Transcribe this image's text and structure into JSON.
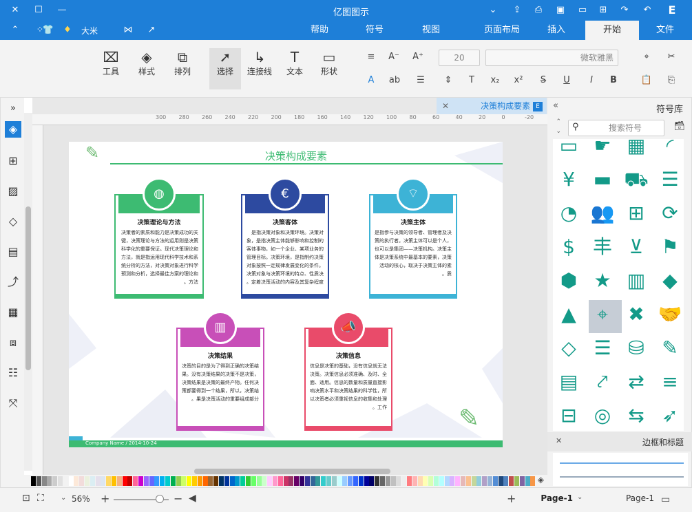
{
  "app": {
    "title": "亿图图示"
  },
  "menu": {
    "items": [
      "文件",
      "开始",
      "插入",
      "页面布局",
      "视图",
      "符号",
      "帮助"
    ],
    "active": "开始"
  },
  "user": {
    "name": "大米"
  },
  "ribbon": {
    "font_name": "微软雅黑",
    "font_size": "20",
    "shape_label": "形状",
    "text_label": "文本",
    "connector_label": "连接线",
    "select_label": "选择",
    "arrange_label": "排列",
    "style_label": "样式",
    "tools_label": "工具"
  },
  "document": {
    "tab_title": "决策构成要素"
  },
  "ruler": {
    "ticks": [
      "-20",
      "0",
      "20",
      "40",
      "60",
      "80",
      "100",
      "120",
      "140",
      "160",
      "180",
      "200",
      "220",
      "240",
      "260",
      "280",
      "300"
    ]
  },
  "diagram": {
    "title": "决策构成要素",
    "footer": "Company Name / 2014-10-24",
    "cards": [
      {
        "title": "决策主体",
        "body": "是指参与决策的领导者、管理者及决策的执行者。决策主体可以是个人，也可以是集团——决策机构。决策主体是决策系统中最基本的要素，决策活动的核心，取决于决策主体的素质。",
        "color": "#3db3d6",
        "icon": "wifi-icon"
      },
      {
        "title": "决策客体",
        "body": "是指决策对象和决策环境。决策对象，是指决策主体能够影响和控制的客体事物，如一个企业、某项业务的管理目标。决策环境，是指制约决策对象按照一定规律发展变化的条件。决策对象与决策环境的特点、性质决定着决策活动的内容及其复杂程度。",
        "color": "#2d4aa0",
        "icon": "euro-icon"
      },
      {
        "title": "决策理论与方法",
        "body": "决策者的素质和能力是决策成功的关键，决策理论与方法的运用则是决策科学化的重要保证。现代决策理论和方法，就是指运用现代科学技术和系统分析的方法，对决策对象进行科学预测和分析，选择最佳方案的理论和方法。",
        "color": "#3dbb72",
        "icon": "basketball-icon"
      },
      {
        "title": "决策信息",
        "body": "信息是决策的基础，没有信息就无法决策。决策信息必须准确、及时、全面、适用。信息的数量和质量直接影响决策水平和决策结果的科学性，所以决策者必须重视信息的收集和处理工作。",
        "color": "#e94b6a",
        "icon": "megaphone-icon"
      },
      {
        "title": "决策结果",
        "body": "决策的目的是为了得到正确的决策结果。没有决策结果的决策不是决策，决策结果是决策的最终产物。任何决策都要得到一个结果，所以，决策结果是决策活动的重要组成部分。",
        "color": "#c84fb8",
        "icon": "chart-icon"
      }
    ]
  },
  "right_panel": {
    "title": "符号库",
    "search_placeholder": "搜索符号",
    "section_label": "边框和标题"
  },
  "status": {
    "page_tab": "Page-1",
    "page_select": "Page-1",
    "zoom": "56%"
  },
  "palette_colors": [
    "#000000",
    "#555555",
    "#888888",
    "#aaaaaa",
    "#cccccc",
    "#e0e0e0",
    "#f2f2f2",
    "#ffffff",
    "#fde9d9",
    "#f2dcdb",
    "#ebf1de",
    "#dbeef3",
    "#e5e0ec",
    "#dce6f1",
    "#ffd966",
    "#ffc000",
    "#f4b183",
    "#ff0000",
    "#c00000",
    "#ff6699",
    "#cc00cc",
    "#9966ff",
    "#6666ff",
    "#3399ff",
    "#00b0f0",
    "#00cccc",
    "#00b050",
    "#92d050",
    "#ccff66",
    "#ffff00",
    "#ffcc00",
    "#ff9900",
    "#ff6600",
    "#996633",
    "#663300",
    "#003366",
    "#003399",
    "#0066cc",
    "#0099cc",
    "#00cc99",
    "#33cc33",
    "#66ff66",
    "#99ff99",
    "#ccffcc",
    "#ffccff",
    "#ff99cc",
    "#ff6699",
    "#cc3366",
    "#993366",
    "#660066",
    "#330066",
    "#333399",
    "#336699",
    "#339999",
    "#33cccc",
    "#66cccc",
    "#99cccc",
    "#ccffff",
    "#99ccff",
    "#6699ff",
    "#3366ff",
    "#0033cc",
    "#000099",
    "#000066",
    "#333333",
    "#666666",
    "#999999",
    "#c0c0c0",
    "#dddddd",
    "#eeeeee",
    "#ff7c80",
    "#ffb3b3",
    "#ffd9b3",
    "#ffffb3",
    "#d9ffb3",
    "#b3ffd9",
    "#b3ffff",
    "#b3d9ff",
    "#d9b3ff",
    "#ffb3ff",
    "#e6b8b7",
    "#fac090",
    "#c4d79b",
    "#92cddc",
    "#b1a0c7",
    "#95b3d7",
    "#538dd5",
    "#1f497d",
    "#4f81bd",
    "#c0504d",
    "#9bbb59",
    "#8064a2",
    "#4bacc6",
    "#f79646"
  ]
}
